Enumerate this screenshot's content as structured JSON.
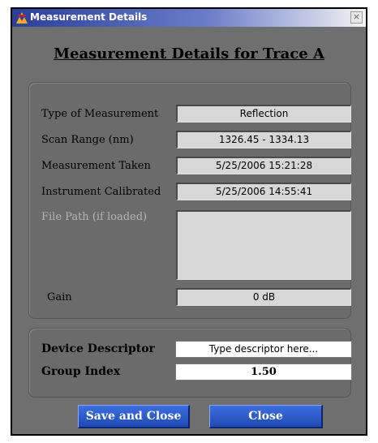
{
  "window": {
    "title": "Measurement Details",
    "close_glyph": "×"
  },
  "heading": "Measurement Details for Trace A",
  "details": [
    {
      "label": "Type of Measurement",
      "value": "Reflection"
    },
    {
      "label": "Scan Range (nm)",
      "value": "1326.45 - 1334.13"
    },
    {
      "label": "Measurement Taken",
      "value": "5/25/2006  15:21:28"
    },
    {
      "label": "Instrument Calibrated",
      "value": "5/25/2006  14:55:41"
    },
    {
      "label": "File Path (if loaded)",
      "value": ""
    },
    {
      "label": "Gain",
      "value": "0 dB"
    }
  ],
  "device": {
    "descriptor_label": "Device Descriptor",
    "descriptor_placeholder": "Type descriptor here...",
    "group_index_label": "Group Index",
    "group_index_value": "1.50"
  },
  "buttons": {
    "save_close": "Save and Close",
    "close": "Close"
  },
  "colors": {
    "button": "#2a55c4",
    "panel": "#6b6b6b",
    "title_bar": "#2b3f99"
  }
}
